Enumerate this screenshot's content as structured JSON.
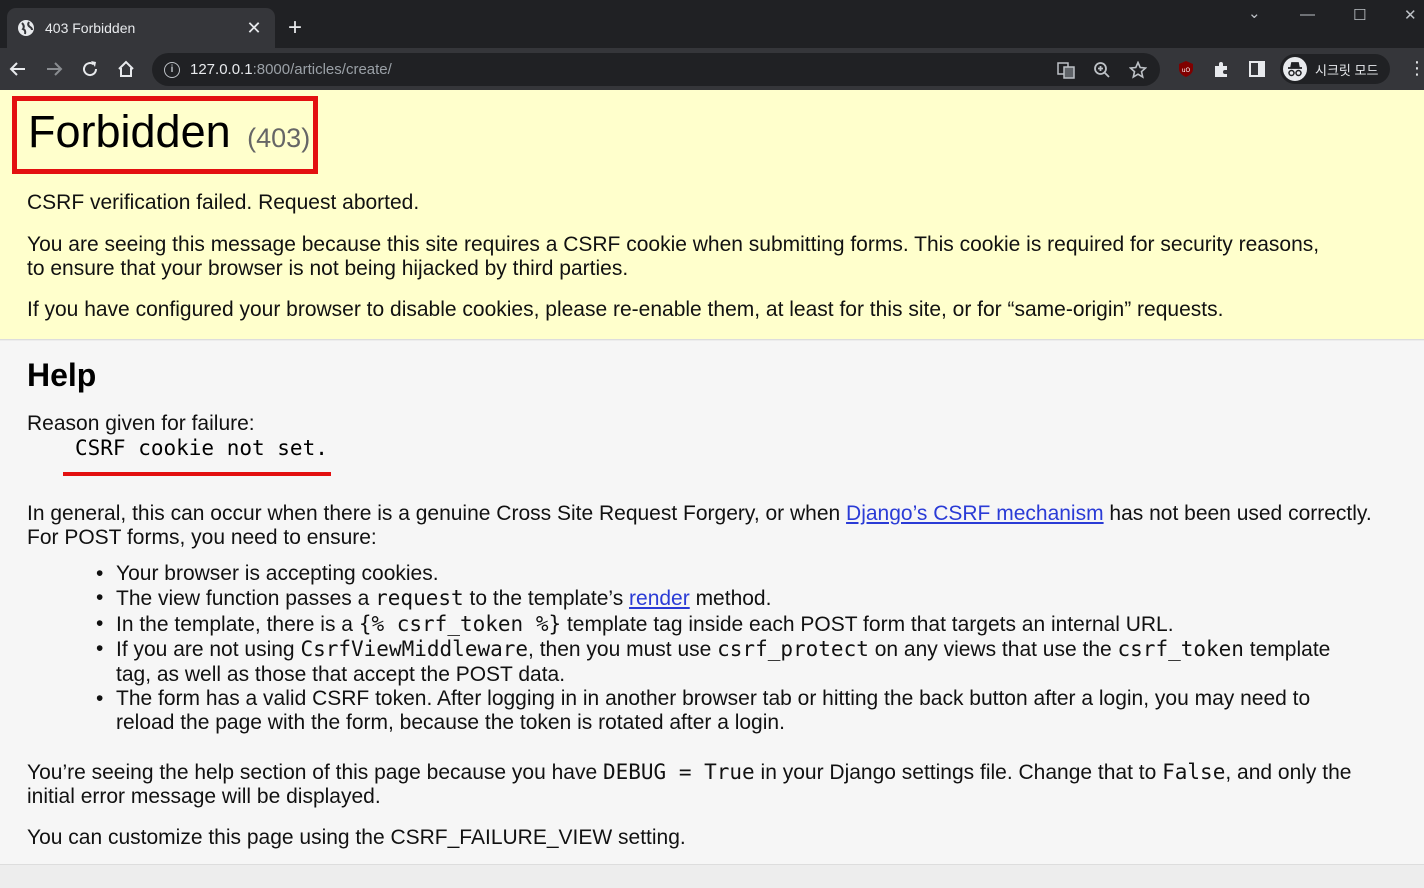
{
  "browser": {
    "tab_title": "403 Forbidden",
    "tab_close": "✕",
    "new_tab": "+",
    "url_host": "127.0.0.1",
    "url_rest": ":8000/articles/create/",
    "incognito_label": "시크릿 모드",
    "controls": {
      "collapse": "⌄",
      "minimize": "—",
      "maximize": "☐",
      "close": "✕"
    }
  },
  "summary": {
    "title": "Forbidden",
    "status_code": "(403)",
    "line1": "CSRF verification failed. Request aborted.",
    "line2": "You are seeing this message because this site requires a CSRF cookie when submitting forms. This cookie is required for security reasons, to ensure that your browser is not being hijacked by third parties.",
    "line3": "If you have configured your browser to disable cookies, please re-enable them, at least for this site, or for “same-origin” requests."
  },
  "help": {
    "heading": "Help",
    "reason_label": "Reason given for failure:",
    "reason_code": "CSRF cookie not set.",
    "general_before": "In general, this can occur when there is a genuine Cross Site Request Forgery, or when ",
    "general_link": "Django’s CSRF mechanism",
    "general_after": " has not been used correctly. For POST forms, you need to ensure:",
    "items": {
      "i1": "Your browser is accepting cookies.",
      "i2_a": "The view function passes a ",
      "i2_code": "request",
      "i2_b": " to the template’s ",
      "i2_link": "render",
      "i2_c": " method.",
      "i3_a": "In the template, there is a ",
      "i3_code": "{% csrf_token %}",
      "i3_b": " template tag inside each POST form that targets an internal URL.",
      "i4_a": "If you are not using ",
      "i4_code1": "CsrfViewMiddleware",
      "i4_b": ", then you must use ",
      "i4_code2": "csrf_protect",
      "i4_c": " on any views that use the ",
      "i4_code3": "csrf_token",
      "i4_d": " template tag, as well as those that accept the POST data.",
      "i5": "The form has a valid CSRF token. After logging in in another browser tab or hitting the back button after a login, you may need to reload the page with the form, because the token is rotated after a login."
    },
    "debug_a": "You’re seeing the help section of this page because you have ",
    "debug_code1": "DEBUG = True",
    "debug_b": " in your Django settings file. Change that to ",
    "debug_code2": "False",
    "debug_c": ", and only the initial error message will be displayed.",
    "customize": "You can customize this page using the CSRF_FAILURE_VIEW setting."
  },
  "colors": {
    "summary_bg": "#ffffcc",
    "highlight_red": "#e31010",
    "link": "#2a3bd6"
  }
}
